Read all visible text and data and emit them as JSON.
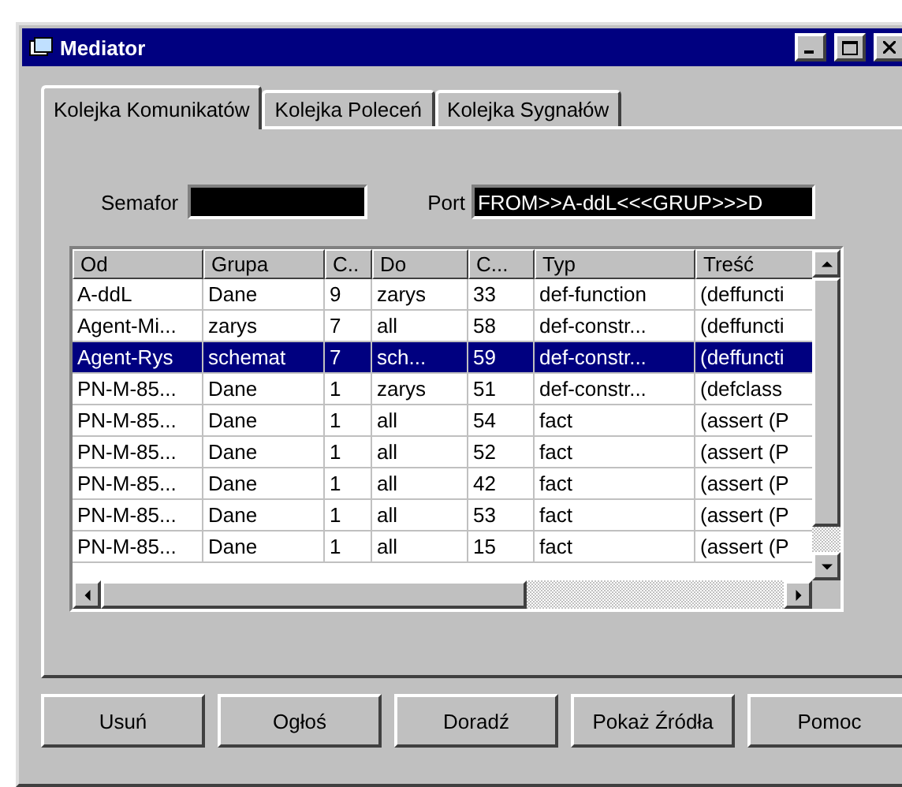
{
  "window": {
    "title": "Mediator"
  },
  "tabs": [
    {
      "label": "Kolejka Komunikatów",
      "selected": true
    },
    {
      "label": "Kolejka Poleceń",
      "selected": false
    },
    {
      "label": "Kolejka Sygnałów",
      "selected": false
    }
  ],
  "semafor": {
    "label": "Semafor"
  },
  "port": {
    "label": "Port",
    "value": "FROM>>A-ddL<<<GRUP>>>D"
  },
  "table": {
    "columns": [
      "Od",
      "Grupa",
      "C..",
      "Do",
      "C...",
      "Typ",
      "Treść"
    ],
    "rows": [
      {
        "cells": [
          "A-ddL",
          "Dane",
          "9",
          "zarys",
          "33",
          "def-function",
          "(deffuncti"
        ],
        "selected": false
      },
      {
        "cells": [
          "Agent-Mi...",
          "zarys",
          "7",
          "all",
          "58",
          "def-constr...",
          "(deffuncti"
        ],
        "selected": false
      },
      {
        "cells": [
          "Agent-Rys",
          "schemat",
          "7",
          "sch...",
          "59",
          "def-constr...",
          "(deffuncti"
        ],
        "selected": true
      },
      {
        "cells": [
          "PN-M-85...",
          "Dane",
          "1",
          "zarys",
          "51",
          "def-constr...",
          "(defclass"
        ],
        "selected": false
      },
      {
        "cells": [
          "PN-M-85...",
          "Dane",
          "1",
          "all",
          "54",
          "fact",
          "(assert (P"
        ],
        "selected": false
      },
      {
        "cells": [
          "PN-M-85...",
          "Dane",
          "1",
          "all",
          "52",
          "fact",
          "(assert (P"
        ],
        "selected": false
      },
      {
        "cells": [
          "PN-M-85...",
          "Dane",
          "1",
          "all",
          "42",
          "fact",
          "(assert (P"
        ],
        "selected": false
      },
      {
        "cells": [
          "PN-M-85...",
          "Dane",
          "1",
          "all",
          "53",
          "fact",
          "(assert (P"
        ],
        "selected": false
      },
      {
        "cells": [
          "PN-M-85...",
          "Dane",
          "1",
          "all",
          "15",
          "fact",
          "(assert (P"
        ],
        "selected": false
      }
    ]
  },
  "buttons": [
    "Usuń",
    "Ogłoś",
    "Doradź",
    "Pokaż Źródła",
    "Pomoc"
  ]
}
